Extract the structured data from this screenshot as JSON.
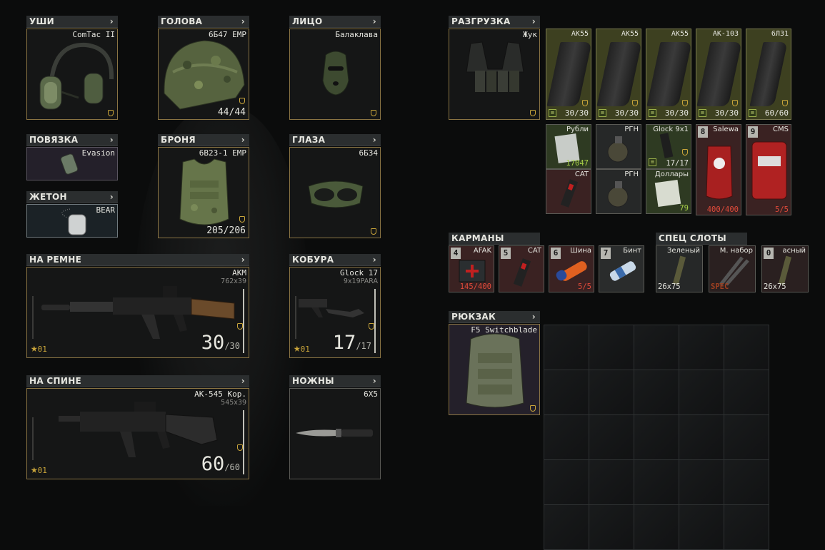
{
  "equipment": {
    "earpiece": {
      "header": "УШИ",
      "chevron": "›",
      "item": "ComTac II"
    },
    "headwear": {
      "header": "ГОЛОВА",
      "chevron": "›",
      "item": "6Б47 EMP",
      "durability": "44/44"
    },
    "face": {
      "header": "ЛИЦО",
      "chevron": "›",
      "item": "Балаклава"
    },
    "armband": {
      "header": "ПОВЯЗКА",
      "chevron": "›",
      "item": "Evasion"
    },
    "armor": {
      "header": "БРОНЯ",
      "chevron": "›",
      "item": "6В23-1 EMP",
      "durability": "205/206"
    },
    "eyewear": {
      "header": "ГЛАЗА",
      "chevron": "›",
      "item": "6Б34"
    },
    "dogtag": {
      "header": "ЖЕТОН",
      "chevron": "›",
      "item": "BEAR"
    },
    "primary": {
      "header": "НА РЕМНЕ",
      "chevron": "›",
      "item": "АКМ",
      "caliber": "762x39",
      "ammo": "30",
      "ammo_max": "/30",
      "level": "01",
      "fill": 1.0
    },
    "holster": {
      "header": "КОБУРА",
      "chevron": "›",
      "item": "Glock 17",
      "caliber": "9x19PARA",
      "ammo": "17",
      "ammo_max": "/17",
      "level": "01",
      "fill": 1.0
    },
    "back": {
      "header": "НА СПИНЕ",
      "chevron": "›",
      "item": "АК-545 Кор.",
      "caliber": "545x39",
      "ammo": "60",
      "ammo_max": "/60",
      "level": "01",
      "fill": 1.0
    },
    "scabbard": {
      "header": "НОЖНЫ",
      "chevron": "›",
      "item": "6Х5"
    }
  },
  "rig": {
    "header": "РАЗГРУЗКА",
    "chevron": "›",
    "item": "Жук",
    "magazines": [
      {
        "name": "АК55",
        "count": "30/30"
      },
      {
        "name": "АК55",
        "count": "30/30"
      },
      {
        "name": "АК55",
        "count": "30/30"
      },
      {
        "name": "АК-103",
        "count": "30/30"
      },
      {
        "name": "6Л31",
        "count": "60/60"
      }
    ],
    "items": [
      {
        "name": "Рубли",
        "value": "17047"
      },
      {
        "name": "РГН",
        "value": ""
      },
      {
        "name": "Glock 9x1",
        "value": "17/17"
      },
      {
        "name": "Salewa",
        "tag": "8",
        "value": "400/400"
      },
      {
        "name": "CMS",
        "tag": "9",
        "value": "5/5"
      },
      {
        "name": "CAT",
        "value": ""
      },
      {
        "name": "РГН",
        "value": ""
      },
      {
        "name": "Доллары",
        "value": "79"
      }
    ]
  },
  "pockets": {
    "header": "КАРМАНЫ",
    "items": [
      {
        "tag": "4",
        "name": "AFAK",
        "value": "145/400"
      },
      {
        "tag": "5",
        "name": "CAT",
        "value": ""
      },
      {
        "tag": "6",
        "name": "Шина",
        "value": "5/5"
      },
      {
        "tag": "7",
        "name": "Бинт",
        "value": ""
      }
    ]
  },
  "special": {
    "header": "СПЕЦ СЛОТЫ",
    "items": [
      {
        "name": "Зеленый",
        "value": "26x75"
      },
      {
        "name": "М. набор",
        "value": "SPEC"
      },
      {
        "tag": "0",
        "name": "асный",
        "value": "26x75"
      }
    ]
  },
  "backpack": {
    "header": "РЮКЗАК",
    "chevron": "›",
    "item": "F5 Switchblade"
  }
}
